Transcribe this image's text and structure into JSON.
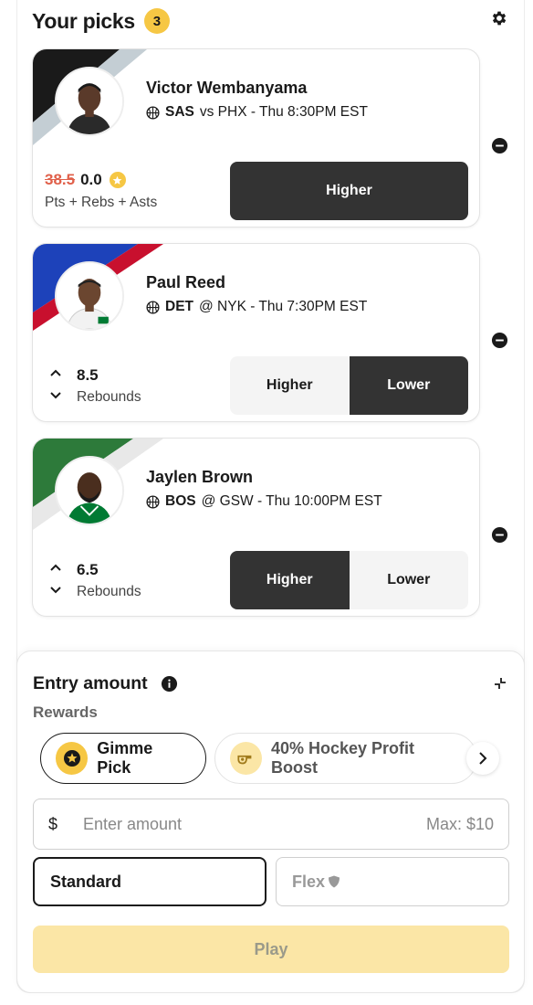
{
  "header": {
    "title": "Your picks",
    "count": "3",
    "settings_icon": "gear-icon"
  },
  "picks": [
    {
      "player": "Victor Wembanyama",
      "team": "SAS",
      "matchup": "vs PHX - Thu 8:30PM EST",
      "old_line": "38.5",
      "new_line": "0.0",
      "stat": "Pts + Rebs + Asts",
      "buttons": [
        "Higher"
      ],
      "selected": "Higher",
      "team_colors": [
        "#1a1a1a",
        "#c4ced4"
      ]
    },
    {
      "player": "Paul Reed",
      "team": "DET",
      "matchup": "@ NYK - Thu 7:30PM EST",
      "line": "8.5",
      "stat": "Rebounds",
      "buttons": [
        "Higher",
        "Lower"
      ],
      "selected": "Lower",
      "team_colors": [
        "#1d42ba",
        "#c8102e"
      ]
    },
    {
      "player": "Jaylen Brown",
      "team": "BOS",
      "matchup": "@ GSW - Thu 10:00PM EST",
      "line": "6.5",
      "stat": "Rebounds",
      "buttons": [
        "Higher",
        "Lower"
      ],
      "selected": "Higher",
      "team_colors": [
        "#007a33",
        "#e8e8e8"
      ]
    }
  ],
  "entry": {
    "title": "Entry amount",
    "rewards_label": "Rewards",
    "rewards": [
      {
        "label": "Gimme Pick",
        "selected": true,
        "icon": "star-badge-icon"
      },
      {
        "label": "40% Hockey Profit Boost",
        "selected": false,
        "icon": "whistle-icon"
      }
    ],
    "amount": {
      "currency": "$",
      "placeholder": "Enter amount",
      "max": "Max: $10"
    },
    "modes": {
      "standard": "Standard",
      "flex": "Flex"
    },
    "play_label": "Play"
  },
  "colors": {
    "accent": "#f6c744",
    "dark_button": "#333333",
    "play_disabled": "#fbe6a6"
  }
}
